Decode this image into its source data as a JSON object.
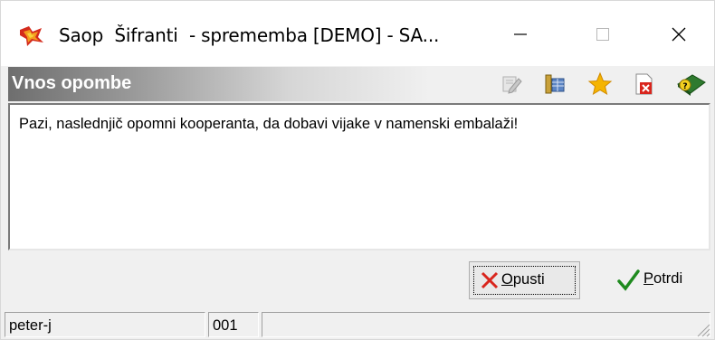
{
  "window": {
    "title": "Saop  Šifranti  - sprememba [DEMO] - SA...",
    "controls": {
      "minimize": "minimize",
      "maximize": "maximize",
      "close": "close"
    }
  },
  "header": {
    "title": "Vnos opombe",
    "toolbar": [
      "edit-icon",
      "columns-icon",
      "star-icon",
      "delete-file-icon",
      "help-book-icon"
    ]
  },
  "note": {
    "text": "Pazi, naslednjič opomni kooperanta, da dobavi vijake v namenski embalaži!"
  },
  "buttons": {
    "cancel": {
      "prefix": "",
      "mnemonic": "O",
      "rest": "pusti"
    },
    "ok": {
      "prefix": "",
      "mnemonic": "P",
      "rest": "otrdi"
    }
  },
  "status": {
    "user": "peter-j",
    "code": "001",
    "extra": ""
  },
  "colors": {
    "cancel_x": "#d9251d",
    "ok_check": "#1e8a1e",
    "star": "#f5b400"
  }
}
